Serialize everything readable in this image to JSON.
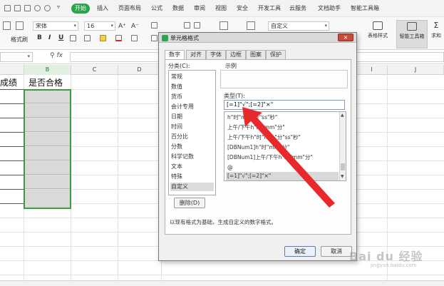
{
  "ribbon": {
    "tabs": [
      "开始",
      "插入",
      "页面布局",
      "公式",
      "数据",
      "审阅",
      "视图",
      "安全",
      "开发工具",
      "云服务",
      "文档助手",
      "智能工具箱"
    ],
    "active_tab": "开始",
    "format_brush": "格式刷",
    "font_name": "宋体",
    "font_size": "16",
    "grow_font": "A⁺",
    "shrink_font": "A⁻",
    "bold": "B",
    "italic": "I",
    "underline": "U",
    "number_format": "自定义",
    "table_style": "表格样式",
    "smart_toolbox": "智能工具箱",
    "sum_btn": "求和"
  },
  "formula_bar": {
    "fx": "fx",
    "zoom_icon": "magnifier-icon"
  },
  "sheet": {
    "columns": [
      "B",
      "C",
      "D",
      "I",
      "J"
    ],
    "cell_a1": "成绩",
    "cell_b1": "是否合格"
  },
  "dialog": {
    "title": "单元格格式",
    "close_label": "×",
    "tabs": [
      "数字",
      "对齐",
      "字体",
      "边框",
      "图案",
      "保护"
    ],
    "active_tab": "数字",
    "category_label": "分类(C):",
    "categories": [
      "常规",
      "数值",
      "货币",
      "会计专用",
      "日期",
      "时间",
      "百分比",
      "分数",
      "科学记数",
      "文本",
      "特殊",
      "自定义"
    ],
    "selected_category": "自定义",
    "sample_label": "示例",
    "type_label": "类型(T):",
    "type_value": "[=1]\"√\";[=2]\"×\"",
    "type_list": [
      "h\"时\"mm\"分\"ss\"秒\"",
      "上午/下午h\"时\"mm\"分\"",
      "上午/下午h\"时\"mm\"分\"ss\"秒\"",
      "[DBNum1]h\"时\"mm\"分\"",
      "[DBNum1]上午/下午h\"时\"mm\"分\"",
      "@",
      "[=1]\"√\";[=2]\"×\""
    ],
    "delete_button": "删除(D)",
    "description": "以现有格式为基础，生成自定义的数字格式。",
    "ok_button": "确定",
    "cancel_button": "取消"
  },
  "watermark": {
    "text": "Bai du 经验",
    "sub": "jingyan.baidu.com"
  },
  "colors": {
    "accent_green": "#2aa54b",
    "selection_border": "#3c9b3c",
    "annotation_arrow": "#e8282b",
    "close_red": "#c94a3c"
  }
}
